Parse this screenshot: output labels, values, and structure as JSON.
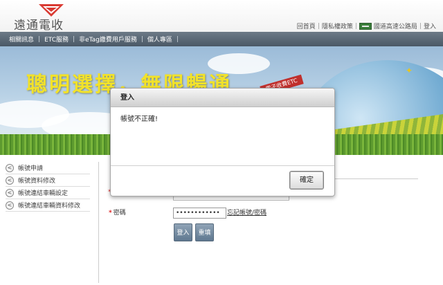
{
  "header": {
    "logo_text": "遠通電收",
    "top_links": [
      "回首頁",
      "隱私權政策",
      "國道高速公路局",
      "登入"
    ],
    "separator": "|"
  },
  "navbar": {
    "items": [
      "相關訊息",
      "ETC服務",
      "非eTag繳費用戶服務",
      "個人專區"
    ],
    "separator": "|"
  },
  "banner": {
    "slogan": "聰明選擇，無限暢通",
    "sign_text": "電子收費ETC"
  },
  "sidebar": {
    "items": [
      {
        "label": "帳號申請"
      },
      {
        "label": "帳號資料修改"
      },
      {
        "label": "帳號連結車輛設定"
      },
      {
        "label": "帳號連結車輛資料修改"
      }
    ],
    "arrow": "<"
  },
  "form": {
    "password_label": "密碼",
    "password_value": "••••••••••••",
    "required_mark": "*",
    "forgot_link": "忘記帳號/密碼",
    "login_button": "登入",
    "reset_button": "重填"
  },
  "dialog": {
    "title": "登入",
    "message": "帳號不正確!",
    "ok_button": "確定"
  },
  "colors": {
    "navbar": "#55636f",
    "slogan": "#f2e22a",
    "required": "#d22222",
    "button": "#6f879d"
  }
}
